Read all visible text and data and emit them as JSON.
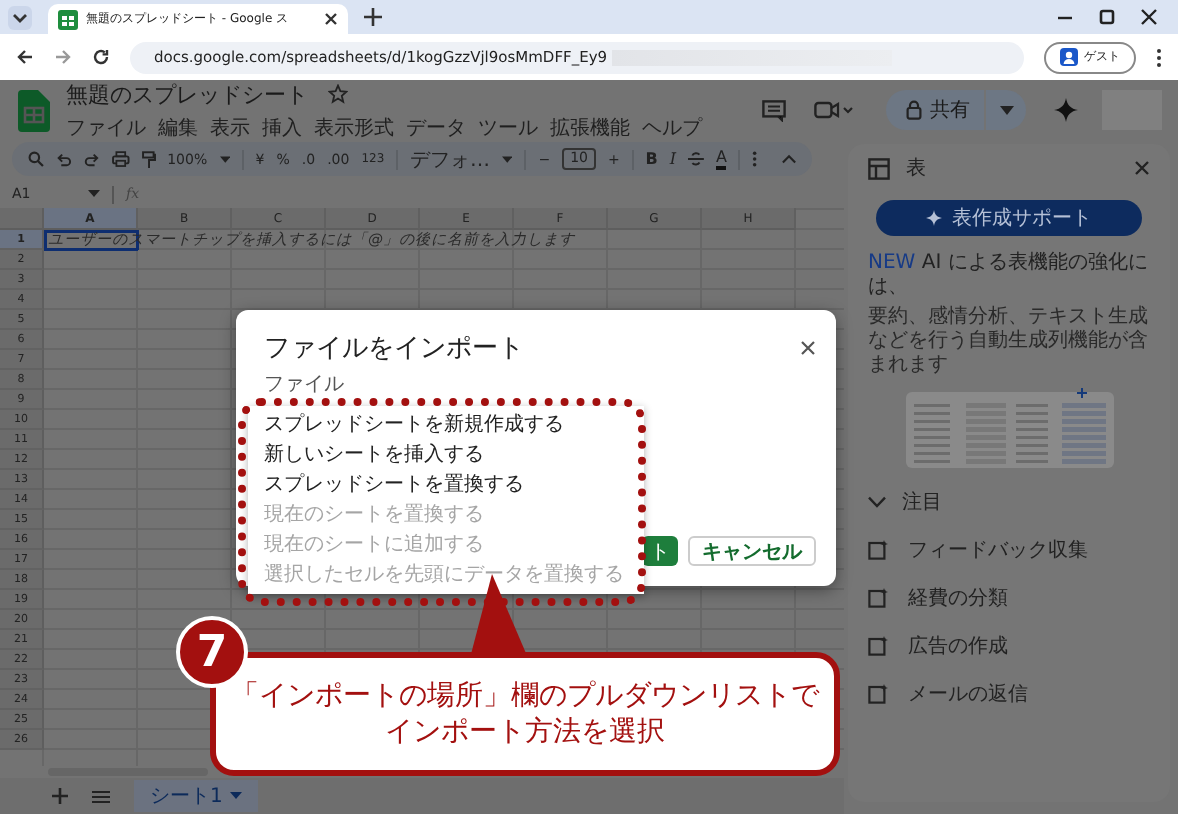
{
  "browser": {
    "tab_title": "無題のスプレッドシート - Google ス",
    "url": "docs.google.com/spreadsheets/d/1kogGzzVjl9osMmDFF_Ey9",
    "profile": "ゲスト"
  },
  "document": {
    "title": "無題のスプレッドシート",
    "menus": [
      "ファイル",
      "編集",
      "表示",
      "挿入",
      "表示形式",
      "データ",
      "ツール",
      "拡張機能",
      "ヘルプ"
    ],
    "share_label": "共有"
  },
  "toolbar": {
    "zoom": "100%",
    "currency": "¥",
    "percent": "%",
    "decrease_decimal": ".0",
    "increase_decimal": ".00",
    "number_format": "123",
    "font": "デフォ…",
    "minus": "−",
    "font_size": "10",
    "plus": "+",
    "bold": "B",
    "italic": "I",
    "text_color": "A"
  },
  "formula_bar": {
    "cell_ref": "A1",
    "fx": "fx"
  },
  "grid": {
    "columns": [
      {
        "label": "A",
        "selected": true
      },
      {
        "label": "B",
        "selected": false
      },
      {
        "label": "C",
        "selected": false
      },
      {
        "label": "D",
        "selected": false
      },
      {
        "label": "E",
        "selected": false
      },
      {
        "label": "F",
        "selected": false
      },
      {
        "label": "G",
        "selected": false
      },
      {
        "label": "H",
        "selected": false
      }
    ],
    "rows": [
      {
        "label": "1",
        "selected": true
      },
      {
        "label": "2",
        "selected": false
      },
      {
        "label": "3",
        "selected": false
      },
      {
        "label": "4",
        "selected": false
      },
      {
        "label": "5",
        "selected": false
      },
      {
        "label": "6",
        "selected": false
      },
      {
        "label": "7",
        "selected": false
      },
      {
        "label": "8",
        "selected": false
      },
      {
        "label": "9",
        "selected": false
      },
      {
        "label": "10",
        "selected": false
      },
      {
        "label": "11",
        "selected": false
      },
      {
        "label": "12",
        "selected": false
      },
      {
        "label": "13",
        "selected": false
      },
      {
        "label": "14",
        "selected": false
      },
      {
        "label": "15",
        "selected": false
      },
      {
        "label": "16",
        "selected": false
      },
      {
        "label": "17",
        "selected": false
      },
      {
        "label": "18",
        "selected": false
      },
      {
        "label": "19",
        "selected": false
      },
      {
        "label": "20",
        "selected": false
      },
      {
        "label": "21",
        "selected": false
      },
      {
        "label": "22",
        "selected": false
      },
      {
        "label": "23",
        "selected": false
      },
      {
        "label": "24",
        "selected": false
      },
      {
        "label": "25",
        "selected": false
      },
      {
        "label": "26",
        "selected": false
      }
    ],
    "a1_hint": "ユーザーのスマートチップを挿入するには「@」の後に名前を入力します"
  },
  "sheet_tabs": [
    {
      "label": "シート1",
      "selected": true
    }
  ],
  "side_panel": {
    "title": "表",
    "primary_button": "表作成サポート",
    "promo_badge": "NEW",
    "promo_title": "AI による表機能の強化には、",
    "promo_text": "要約、感情分析、テキスト生成などを行う自動生成列機能が含まれます",
    "section": {
      "title": "注目",
      "expanded": true,
      "items": [
        "フィードバック収集",
        "経費の分類",
        "広告の作成",
        "メールの返信"
      ]
    }
  },
  "dialog": {
    "title": "ファイルをインポート",
    "field_label": "ファイル",
    "menu": [
      {
        "label": "スプレッドシートを新規作成する",
        "disabled": false
      },
      {
        "label": "新しいシートを挿入する",
        "disabled": false
      },
      {
        "label": "スプレッドシートを置換する",
        "disabled": false
      },
      {
        "label": "現在のシートを置換する",
        "disabled": true
      },
      {
        "label": "現在のシートに追加する",
        "disabled": true
      },
      {
        "label": "選択したセルを先頭にデータを置換する",
        "disabled": true
      }
    ],
    "buttons": [
      {
        "label": "ト",
        "kind": "primary"
      },
      {
        "label": "キャンセル",
        "kind": "secondary"
      }
    ]
  },
  "annotation": {
    "step": "7",
    "text_lines": [
      "「インポートの場所」欄のプルダウンリストで",
      "インポート方法を選択"
    ]
  }
}
